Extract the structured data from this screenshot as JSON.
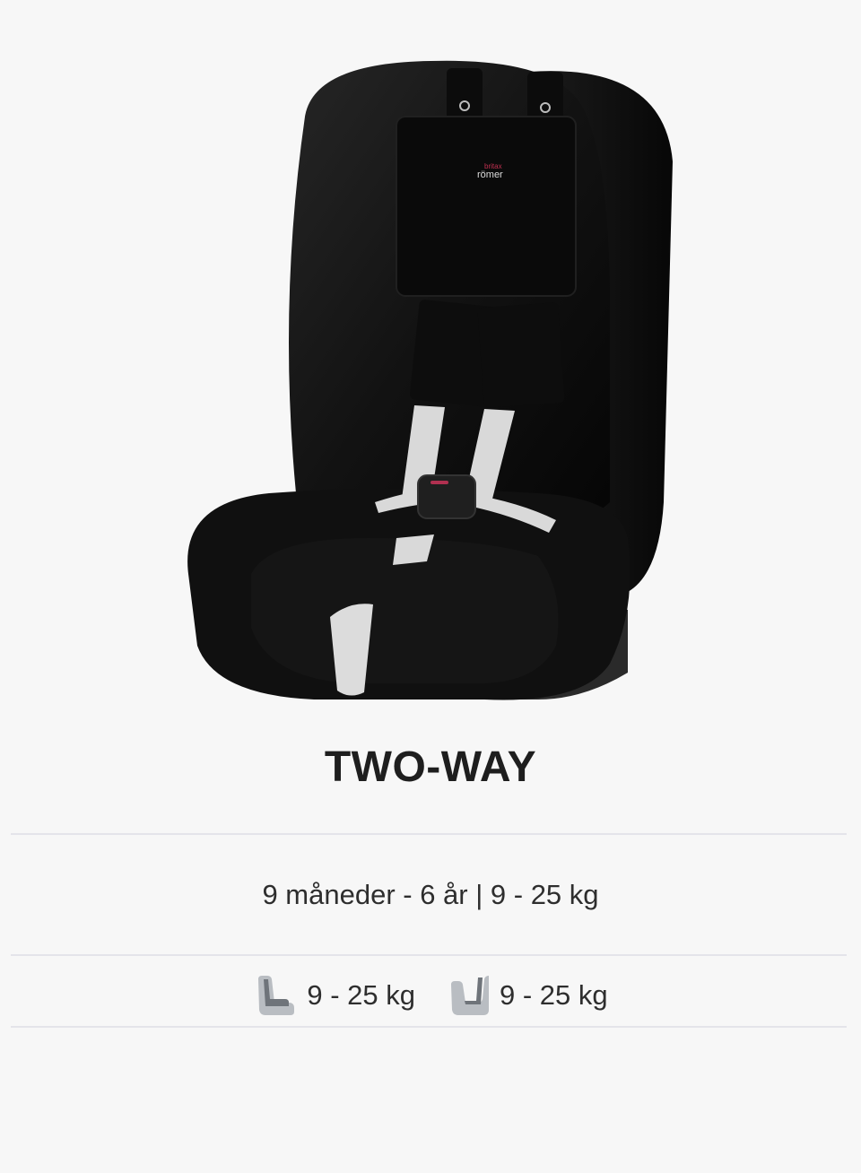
{
  "product": {
    "brand_logo": "britax römer",
    "title": "TWO-WAY",
    "age_weight_range": "9 måneder - 6 år | 9 - 25 kg"
  },
  "specs": [
    {
      "icon": "forward-facing-seat-icon",
      "label": "9 - 25 kg"
    },
    {
      "icon": "rear-facing-seat-icon",
      "label": "9 - 25 kg"
    }
  ],
  "colors": {
    "background": "#f7f7f7",
    "seat_fabric": "#141414",
    "harness_strap": "#d9d9d9",
    "icon_gray": "#9ea2a8"
  }
}
